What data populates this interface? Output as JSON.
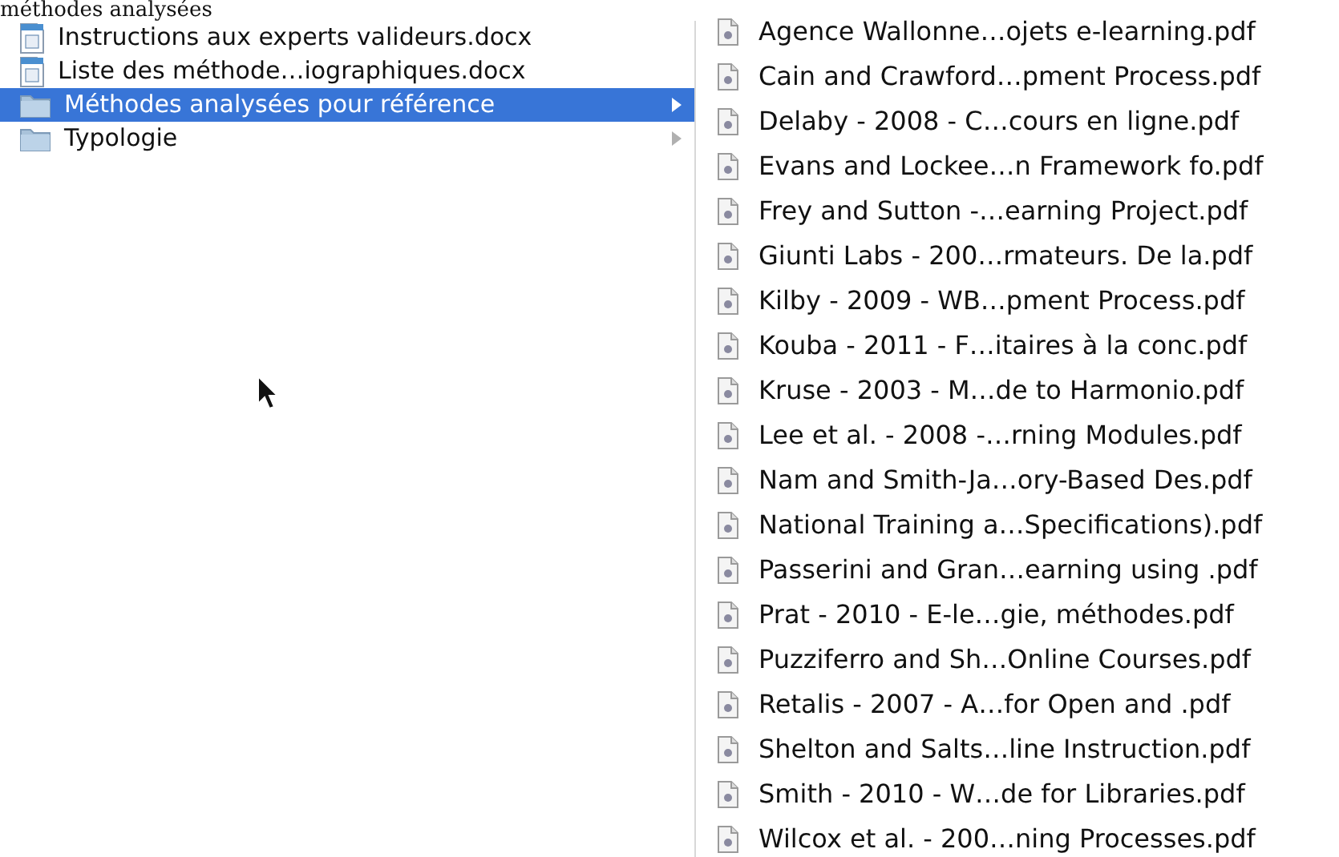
{
  "caption": "méthodes analysées",
  "left_column": [
    {
      "name": "Instructions aux experts valideurs.docx",
      "kind": "document",
      "selected": false
    },
    {
      "name": "Liste des méthode…iographiques.docx",
      "kind": "document",
      "selected": false
    },
    {
      "name": "Méthodes analysées pour référence",
      "kind": "folder",
      "selected": true
    },
    {
      "name": "Typologie",
      "kind": "folder",
      "selected": false
    }
  ],
  "right_column": [
    {
      "name": "Agence Wallonne…ojets e-learning.pdf"
    },
    {
      "name": "Cain and Crawford…pment Process.pdf"
    },
    {
      "name": "Delaby - 2008 - C…cours en ligne.pdf"
    },
    {
      "name": "Evans and Lockee…n Framework fo.pdf"
    },
    {
      "name": "Frey and Sutton -…earning Project.pdf"
    },
    {
      "name": "Giunti Labs - 200…rmateurs. De la.pdf"
    },
    {
      "name": "Kilby - 2009 - WB…pment Process.pdf"
    },
    {
      "name": "Kouba - 2011 - F…itaires à la conc.pdf"
    },
    {
      "name": "Kruse - 2003 - M…de to Harmonio.pdf"
    },
    {
      "name": "Lee et al. - 2008 -…rning Modules.pdf"
    },
    {
      "name": "Nam and Smith-Ja…ory-Based Des.pdf"
    },
    {
      "name": "National Training a…Specifications).pdf"
    },
    {
      "name": "Passerini and Gran…earning using .pdf"
    },
    {
      "name": "Prat - 2010 - E-le…gie, méthodes.pdf"
    },
    {
      "name": "Puzziferro and Sh…Online Courses.pdf"
    },
    {
      "name": "Retalis - 2007 - A…for Open and .pdf"
    },
    {
      "name": "Shelton and Salts…line Instruction.pdf"
    },
    {
      "name": "Smith - 2010 - W…de for Libraries.pdf"
    },
    {
      "name": "Wilcox et al. - 200…ning Processes.pdf"
    }
  ]
}
